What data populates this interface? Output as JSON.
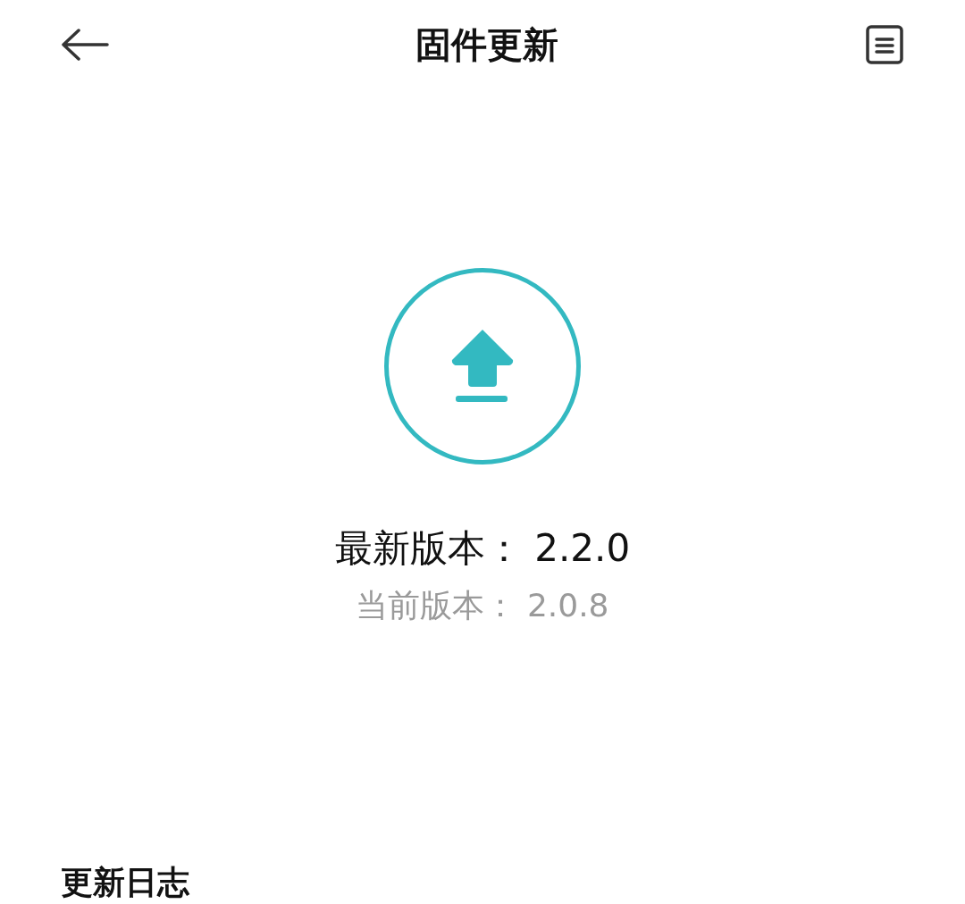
{
  "header": {
    "title": "固件更新"
  },
  "version": {
    "latest": "最新版本： 2.2.0",
    "current": "当前版本： 2.0.8"
  },
  "changelog": {
    "title": "更新日志"
  }
}
